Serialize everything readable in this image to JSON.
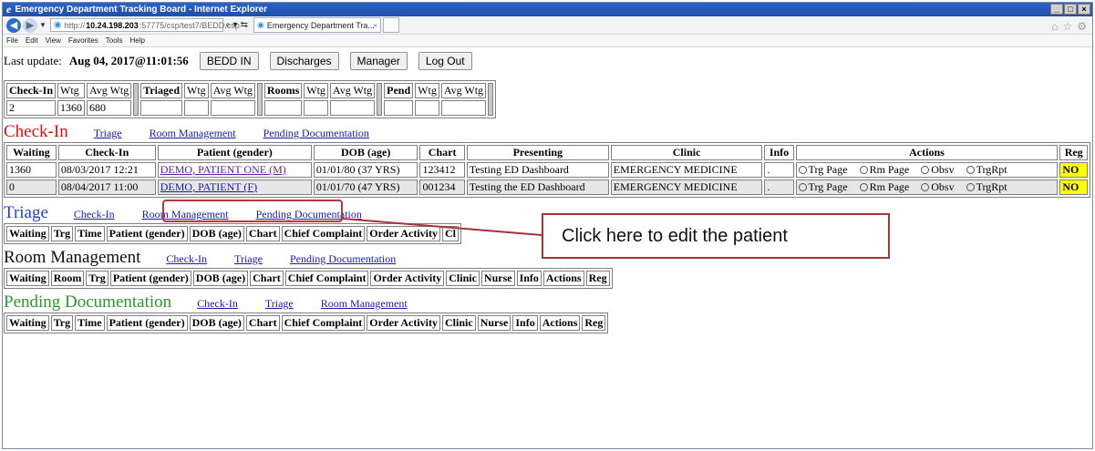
{
  "window": {
    "title": "Emergency Department Tracking Board - Internet Explorer",
    "url_prefix": "http://",
    "url_host": "10.24.198.203",
    "url_path": ":57775/csp/test7/BEDD.csp",
    "tab_title": "Emergency Department Tra...",
    "tab_close": "×",
    "menu": [
      "File",
      "Edit",
      "View",
      "Favorites",
      "Tools",
      "Help"
    ]
  },
  "toolbar": {
    "last_update_label": "Last update:",
    "last_update_value": "Aug 04, 2017@11:01:56",
    "buttons": [
      "BEDD IN",
      "Discharges",
      "Manager",
      "Log Out"
    ]
  },
  "summary": {
    "headers": [
      "Check-In",
      "Wtg",
      "Avg Wtg",
      "Triaged",
      "Wtg",
      "Avg Wtg",
      "Rooms",
      "Wtg",
      "Avg Wtg",
      "Pend",
      "Wtg",
      "Avg Wtg"
    ],
    "values": [
      "2",
      "1360",
      "680",
      "",
      "",
      "",
      "",
      "",
      "",
      "",
      "",
      ""
    ]
  },
  "sections": {
    "checkin": {
      "title": "Check-In",
      "color": "#e01010",
      "links": [
        "Triage",
        "Room Management",
        "Pending Documentation"
      ],
      "headers": [
        "Waiting",
        "Check-In",
        "Patient (gender)",
        "DOB (age)",
        "Chart",
        "Presenting",
        "Clinic",
        "Info",
        "Actions",
        "Reg"
      ],
      "rows": [
        {
          "waiting": "1360",
          "checkin": "08/03/2017 12:21",
          "patient": "DEMO, PATIENT ONE (M)",
          "dob": "01/01/80 (37 YRS)",
          "chart": "123412",
          "presenting": "Testing ED Dashboard",
          "clinic": "EMERGENCY MEDICINE",
          "info": ".",
          "reg": "NO"
        },
        {
          "waiting": "0",
          "checkin": "08/04/2017 11:00",
          "patient": "DEMO, PATIENT (F)",
          "dob": "01/01/70 (47 YRS)",
          "chart": "001234",
          "presenting": "Testing the ED Dashboard",
          "clinic": "EMERGENCY MEDICINE",
          "info": ".",
          "reg": "NO"
        }
      ],
      "actions": [
        "Trg Page",
        "Rm Page",
        "Obsv",
        "TrgRpt"
      ]
    },
    "triage": {
      "title": "Triage",
      "color": "#1f3fd0",
      "links": [
        "Check-In",
        "Room Management",
        "Pending Documentation"
      ],
      "headers": [
        "Waiting",
        "Trg",
        "Time",
        "Patient (gender)",
        "DOB (age)",
        "Chart",
        "Chief Complaint",
        "Order Activity",
        "Cl"
      ]
    },
    "room": {
      "title": "Room Management",
      "color": "#111111",
      "links": [
        "Check-In",
        "Triage",
        "Pending Documentation"
      ],
      "headers": [
        "Waiting",
        "Room",
        "Trg",
        "Patient (gender)",
        "DOB (age)",
        "Chart",
        "Chief Complaint",
        "Order Activity",
        "Clinic",
        "Nurse",
        "Info",
        "Actions",
        "Reg"
      ]
    },
    "pending": {
      "title": "Pending Documentation",
      "color": "#2a9a2a",
      "links": [
        "Check-In",
        "Triage",
        "Room Management"
      ],
      "headers": [
        "Waiting",
        "Trg",
        "Time",
        "Patient (gender)",
        "DOB (age)",
        "Chart",
        "Chief Complaint",
        "Order Activity",
        "Clinic",
        "Nurse",
        "Info",
        "Actions",
        "Reg"
      ]
    }
  },
  "annotation": {
    "callout_text": "Click here to edit the patient",
    "color": "#a8323a"
  }
}
